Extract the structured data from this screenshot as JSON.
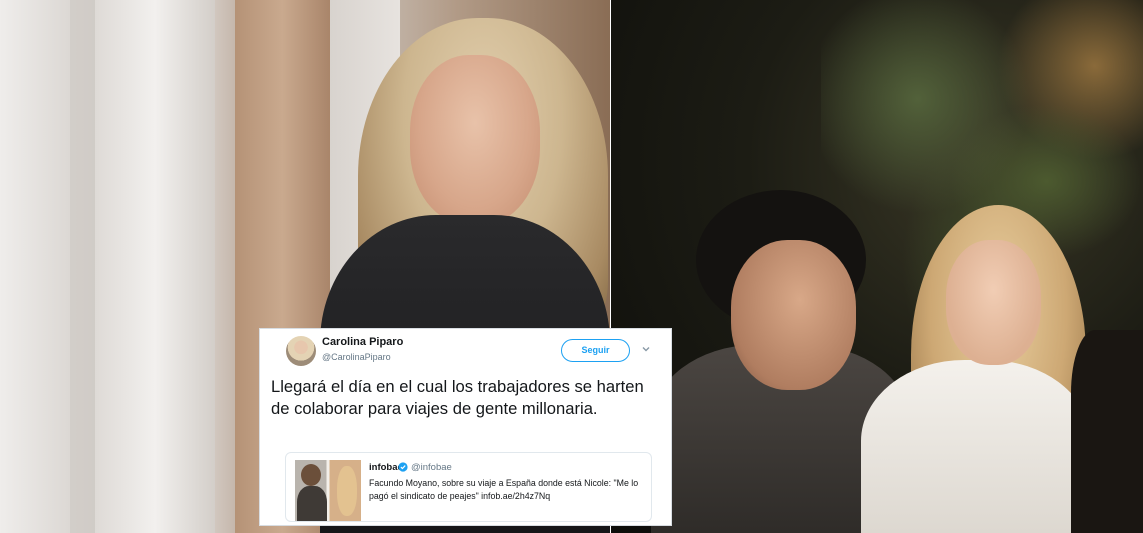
{
  "tweet": {
    "author_name": "Carolina Piparo",
    "author_handle": "@CarolinaPiparo",
    "follow_label": "Seguir",
    "text": "Llegará el día en el cual los trabajadores se harten de colaborar para viajes de gente millonaria.",
    "quote": {
      "author_name": "infobae",
      "author_handle": "@infobae",
      "text": "Facundo Moyano, sobre su viaje a España donde está Nicole: \"Me lo pagó el sindicato de peajes\" infob.ae/2h4z7Nq"
    }
  },
  "colors": {
    "accent": "#1da1f2",
    "text_primary": "#14171a",
    "text_secondary": "#657786",
    "border": "#e1e8ed"
  },
  "icons": {
    "menu": "chevron-down-icon",
    "verified": "verified-badge-icon"
  }
}
